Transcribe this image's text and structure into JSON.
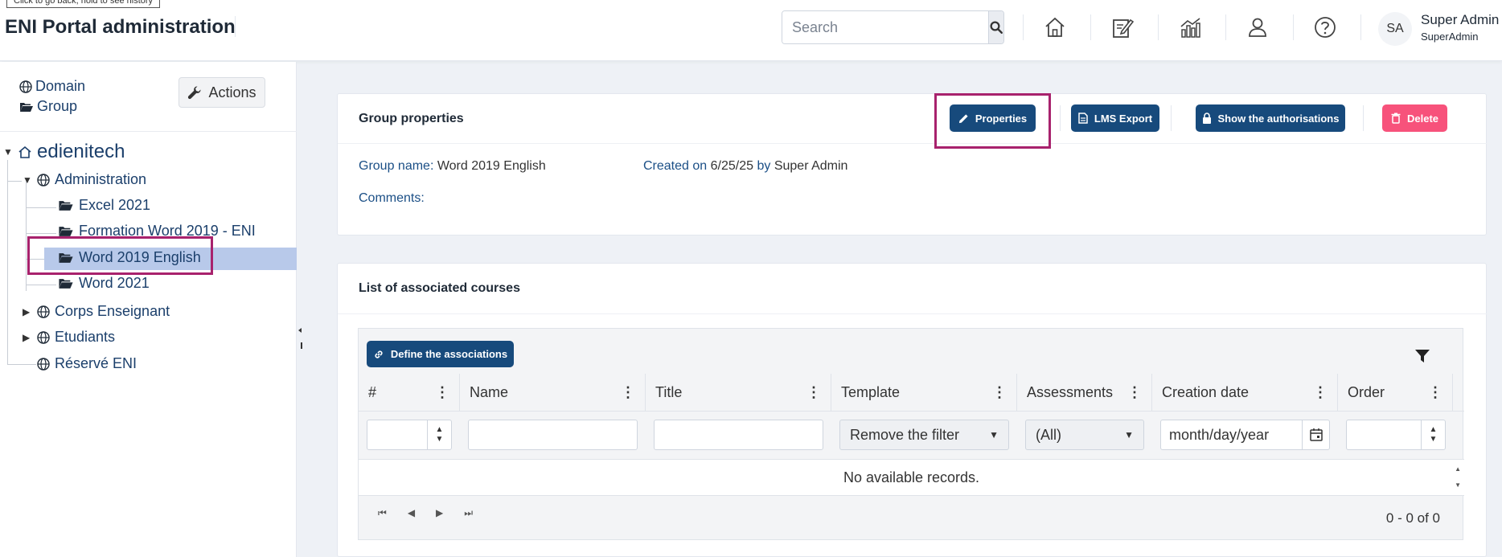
{
  "tooltip": "Click to go back, hold to see history",
  "header": {
    "title": "ENI Portal administration",
    "search_placeholder": "Search",
    "user": {
      "initials": "SA",
      "name": "Super Admin",
      "login": "SuperAdmin"
    },
    "icons": [
      "home-icon",
      "edit-note-icon",
      "stats-chart-icon",
      "user-icon",
      "help-icon"
    ]
  },
  "sidebar": {
    "domain_label": "Domain",
    "group_label": "Group",
    "actions_label": "Actions",
    "tree": {
      "root": "edienitech",
      "administration": "Administration",
      "children": [
        "Excel 2021",
        "Formation Word 2019 - ENI",
        "Word 2019 English",
        "Word 2021"
      ],
      "corps": "Corps Enseignant",
      "etudiants": "Etudiants",
      "reserve": "Réservé ENI"
    }
  },
  "properties": {
    "title": "Group properties",
    "buttons": {
      "properties": "Properties",
      "lms_export": "LMS Export",
      "show_auth": "Show the authorisations",
      "delete": "Delete"
    },
    "group_name_label": "Group name:",
    "group_name": "Word 2019 English",
    "created_on_label": "Created on",
    "created_date": "6/25/25",
    "by_label": "by",
    "created_by": "Super Admin",
    "comments_label": "Comments:"
  },
  "courses": {
    "title": "List of associated courses",
    "define_btn": "Define the associations",
    "columns": [
      "#",
      "Name",
      "Title",
      "Template",
      "Assessments",
      "Creation date",
      "Order"
    ],
    "filters": {
      "template": "Remove the filter",
      "assessments": "(All)",
      "date_placeholder": "month/day/year"
    },
    "empty": "No available records.",
    "pager_info": "0 - 0 of 0"
  }
}
